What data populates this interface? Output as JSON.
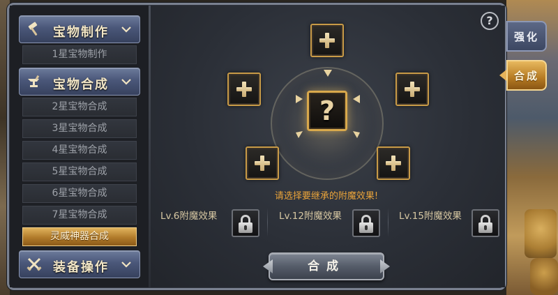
{
  "sidebar": {
    "groups": [
      {
        "label": "宝物制作",
        "icon": "hammer-icon",
        "items": [
          "1星宝物制作"
        ]
      },
      {
        "label": "宝物合成",
        "icon": "anvil-icon",
        "items": [
          "2星宝物合成",
          "3星宝物合成",
          "4星宝物合成",
          "5星宝物合成",
          "6星宝物合成",
          "7星宝物合成",
          "灵威神器合成"
        ],
        "active_item": "灵威神器合成"
      },
      {
        "label": "装备操作",
        "icon": "crossed-swords-icon",
        "items": []
      }
    ]
  },
  "right_tabs": [
    {
      "label": "强化",
      "selected": false
    },
    {
      "label": "合成",
      "selected": true
    }
  ],
  "help": {
    "icon": "help-icon",
    "symbol": "?"
  },
  "synthesis": {
    "center_symbol": "?",
    "hint": "请选择要继承的附魔效果!",
    "enchant_slots": [
      {
        "label": "Lv.6附魔效果",
        "locked": true
      },
      {
        "label": "Lv.12附魔效果",
        "locked": true
      },
      {
        "label": "Lv.15附魔效果",
        "locked": true
      }
    ],
    "button_label": "合成"
  },
  "colors": {
    "accent_gold": "#d9a94c",
    "hint_orange": "#e9a33a",
    "header_blue": "#4a5779"
  }
}
